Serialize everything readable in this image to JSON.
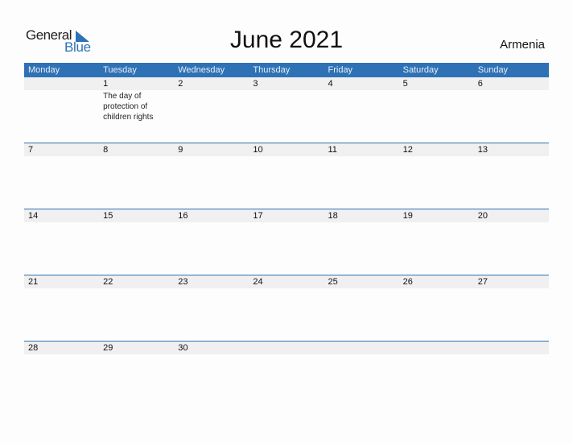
{
  "logo": {
    "word1": "General",
    "word2": "Blue"
  },
  "header": {
    "title": "June 2021",
    "country": "Armenia"
  },
  "colors": {
    "accent": "#2e72b5",
    "band": "#f0f0f0"
  },
  "weekdays": [
    "Monday",
    "Tuesday",
    "Wednesday",
    "Thursday",
    "Friday",
    "Saturday",
    "Sunday"
  ],
  "weeks": [
    {
      "days": [
        {
          "num": "",
          "event": ""
        },
        {
          "num": "1",
          "event": "The day of protection of children rights"
        },
        {
          "num": "2",
          "event": ""
        },
        {
          "num": "3",
          "event": ""
        },
        {
          "num": "4",
          "event": ""
        },
        {
          "num": "5",
          "event": ""
        },
        {
          "num": "6",
          "event": ""
        }
      ]
    },
    {
      "days": [
        {
          "num": "7",
          "event": ""
        },
        {
          "num": "8",
          "event": ""
        },
        {
          "num": "9",
          "event": ""
        },
        {
          "num": "10",
          "event": ""
        },
        {
          "num": "11",
          "event": ""
        },
        {
          "num": "12",
          "event": ""
        },
        {
          "num": "13",
          "event": ""
        }
      ]
    },
    {
      "days": [
        {
          "num": "14",
          "event": ""
        },
        {
          "num": "15",
          "event": ""
        },
        {
          "num": "16",
          "event": ""
        },
        {
          "num": "17",
          "event": ""
        },
        {
          "num": "18",
          "event": ""
        },
        {
          "num": "19",
          "event": ""
        },
        {
          "num": "20",
          "event": ""
        }
      ]
    },
    {
      "days": [
        {
          "num": "21",
          "event": ""
        },
        {
          "num": "22",
          "event": ""
        },
        {
          "num": "23",
          "event": ""
        },
        {
          "num": "24",
          "event": ""
        },
        {
          "num": "25",
          "event": ""
        },
        {
          "num": "26",
          "event": ""
        },
        {
          "num": "27",
          "event": ""
        }
      ]
    },
    {
      "days": [
        {
          "num": "28",
          "event": ""
        },
        {
          "num": "29",
          "event": ""
        },
        {
          "num": "30",
          "event": ""
        },
        {
          "num": "",
          "event": ""
        },
        {
          "num": "",
          "event": ""
        },
        {
          "num": "",
          "event": ""
        },
        {
          "num": "",
          "event": ""
        }
      ]
    }
  ]
}
